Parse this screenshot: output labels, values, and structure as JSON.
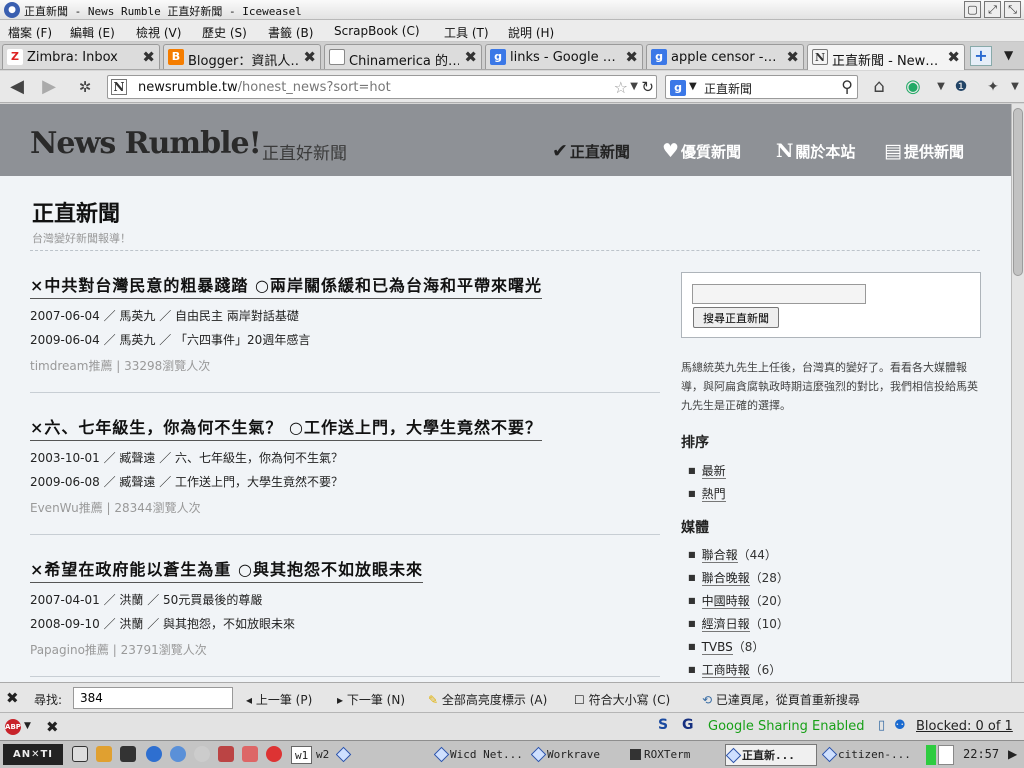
{
  "window": {
    "title": "正直新聞 - News Rumble 正直好新聞 - Iceweasel"
  },
  "menu": [
    "檔案 (F)",
    "編輯 (E)",
    "檢視 (V)",
    "歷史 (S)",
    "書籤 (B)",
    "ScrapBook (C)",
    "工具 (T)",
    "說明 (H)"
  ],
  "tabs": [
    {
      "label": "Zimbra: Inbox",
      "icon": "zimbra-icon"
    },
    {
      "label": "Blogger：資訊人…",
      "icon": "blogger-icon"
    },
    {
      "label": "Chinamerica 的…",
      "icon": "blank-page-icon"
    },
    {
      "label": "links - Google …",
      "icon": "google-icon"
    },
    {
      "label": "apple censor -…",
      "icon": "google-icon"
    },
    {
      "label": "正直新聞 - New…",
      "icon": "newsrumble-icon"
    }
  ],
  "nav": {
    "url_host": "newsrumble.tw",
    "url_path": "/honest_news?sort=hot",
    "search_value": "正直新聞"
  },
  "site": {
    "logo": "News Rumble!",
    "logo_sub": "正直好新聞",
    "nav": [
      {
        "label": "正直新聞",
        "icon": "check-icon"
      },
      {
        "label": "優質新聞",
        "icon": "heart-icon"
      },
      {
        "label": "關於本站",
        "icon": "n-logo-icon"
      },
      {
        "label": "提供新聞",
        "icon": "speech-bubble-icon"
      }
    ]
  },
  "page": {
    "title": "正直新聞",
    "subtitle": "台灣變好新聞報導！"
  },
  "stories": [
    {
      "headline": "×中共對台灣民意的粗暴踐踏 ○兩岸關係緩和已為台海和平帶來曙光",
      "rows": [
        {
          "date": "2007-06-04",
          "author": "馬英九",
          "title": "自由民主 兩岸對話基礎"
        },
        {
          "date": "2009-06-04",
          "author": "馬英九",
          "title": "「六四事件」20週年感言"
        }
      ],
      "submitter": "timdream推薦",
      "views": "33298瀏覽人次"
    },
    {
      "headline": "×六、七年級生，你為何不生氣？ ○工作送上門，大學生竟然不要？",
      "rows": [
        {
          "date": "2003-10-01",
          "author": "臧聲遠",
          "title": "六、七年級生，你為何不生氣？"
        },
        {
          "date": "2009-06-08",
          "author": "臧聲遠",
          "title": "工作送上門，大學生竟然不要？"
        }
      ],
      "submitter": "EvenWu推薦",
      "views": "28344瀏覽人次"
    },
    {
      "headline": "×希望在政府能以蒼生為重 ○與其抱怨不如放眼未來",
      "rows": [
        {
          "date": "2007-04-01",
          "author": "洪蘭",
          "title": "50元買最後的尊嚴"
        },
        {
          "date": "2008-09-10",
          "author": "洪蘭",
          "title": "與其抱怨，不如放眼未來"
        }
      ],
      "submitter": "Papagino推薦",
      "views": "23791瀏覽人次"
    }
  ],
  "sidebar": {
    "search_button": "搜尋正直新聞",
    "intro": "馬總統英九先生上任後，台灣真的變好了。看看各大媒體報導，與阿扁貪腐執政時期這麼強烈的對比，我們相信投給馬英九先生是正確的選擇。",
    "sort_heading": "排序",
    "sort_items": [
      "最新",
      "熱門"
    ],
    "media_heading": "媒體",
    "media_items": [
      {
        "name": "聯合報",
        "count": "（44）"
      },
      {
        "name": "聯合晚報",
        "count": "（28）"
      },
      {
        "name": "中國時報",
        "count": "（20）"
      },
      {
        "name": "經濟日報",
        "count": "（10）"
      },
      {
        "name": "TVBS",
        "count": "（8）"
      },
      {
        "name": "工商時報",
        "count": "（6）"
      }
    ]
  },
  "findbar": {
    "label": "尋找:",
    "value": "384",
    "prev": "上一筆 (P)",
    "next": "下一筆 (N)",
    "highlight": "全部高亮度標示 (A)",
    "match_case": "符合大小寫 (C)",
    "status": "已達頁尾，從頁首重新搜尋"
  },
  "statusbar": {
    "sharing": "Google Sharing Enabled",
    "blocked": "Blocked: 0 of 1"
  },
  "taskbar": {
    "workspaces": [
      "w1",
      "w2"
    ],
    "tasks": [
      "Wicd Net...",
      "Workrave",
      "ROXTerm",
      "正直新...",
      "citizen-..."
    ],
    "clock": "22:57"
  }
}
